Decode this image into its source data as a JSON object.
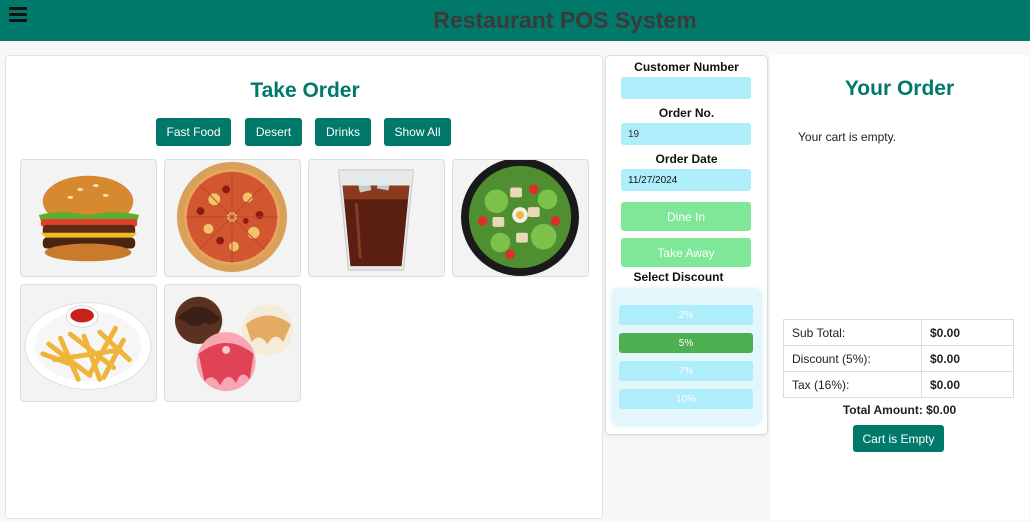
{
  "header": {
    "title": "Restaurant POS System",
    "menu_icon": "hamburger-menu-icon"
  },
  "take_order": {
    "title": "Take Order",
    "categories": [
      "Fast Food",
      "Desert",
      "Drinks",
      "Show All"
    ],
    "items": [
      {
        "image": "burger"
      },
      {
        "image": "pizza"
      },
      {
        "image": "cola"
      },
      {
        "image": "salad"
      },
      {
        "image": "french-fries"
      },
      {
        "image": "ice-cream"
      }
    ]
  },
  "order_form": {
    "customer_number_label": "Customer Number",
    "customer_number_value": "",
    "order_no_label": "Order No.",
    "order_no_value": "19",
    "order_date_label": "Order Date",
    "order_date_value": "11/27/2024",
    "dine_in_label": "Dine In",
    "take_away_label": "Take Away",
    "discount_label": "Select Discount",
    "discounts": [
      "2%",
      "5%",
      "7%",
      "10%"
    ],
    "selected_discount": "5%"
  },
  "your_order": {
    "title": "Your Order",
    "empty_message": "Your cart is empty.",
    "totals": [
      {
        "label": "Sub Total:",
        "value": "$0.00"
      },
      {
        "label": "Discount (5%):",
        "value": "$0.00"
      },
      {
        "label": "Tax (16%):",
        "value": "$0.00"
      }
    ],
    "total_amount": "Total Amount: $0.00",
    "checkout_label": "Cart is Empty"
  },
  "colors": {
    "brand": "#00796b",
    "input_bg": "#aeeefa",
    "order_type_btn": "#7fe898",
    "discount_active": "#4caf50"
  }
}
